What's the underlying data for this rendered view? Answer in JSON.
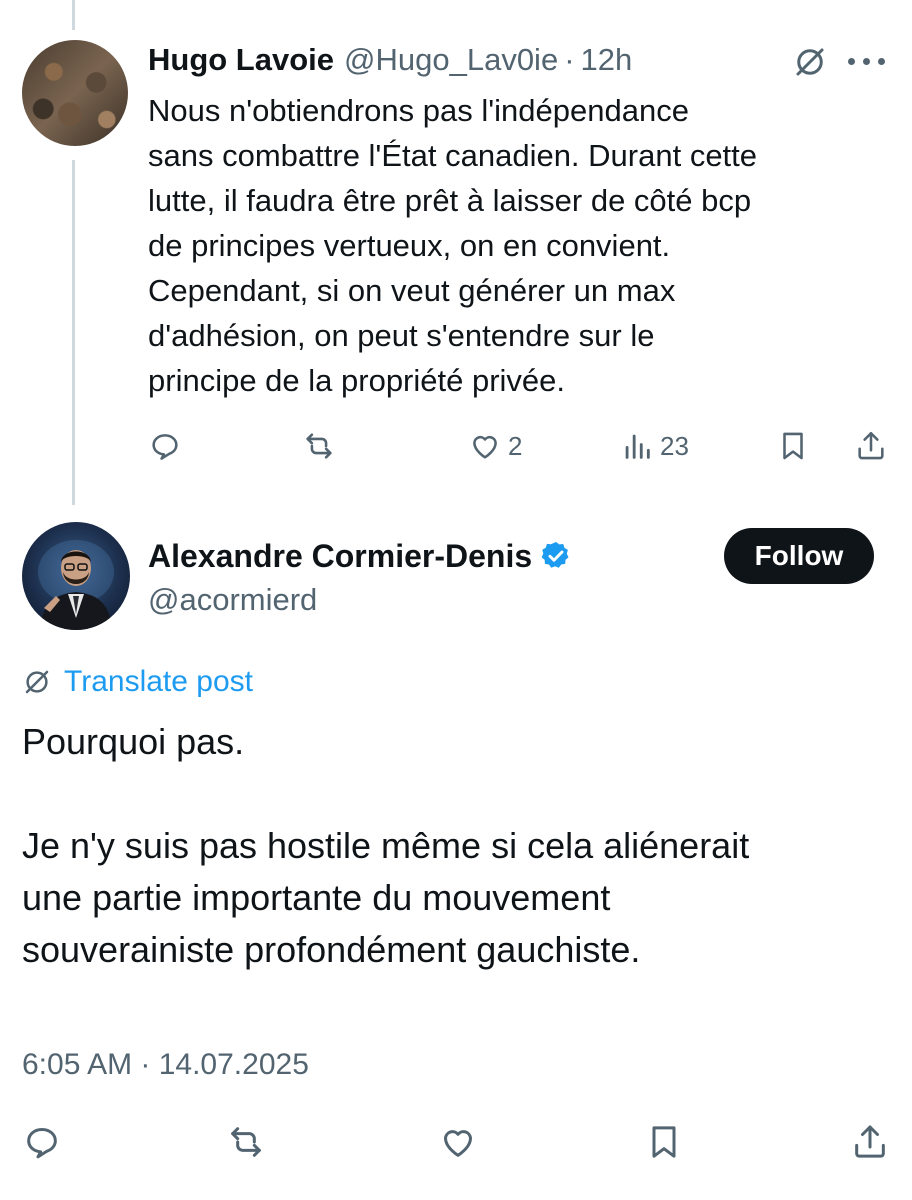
{
  "parent_post": {
    "author_name": "Hugo Lavoie",
    "author_handle": "@Hugo_Lav0ie",
    "separator": "·",
    "time": "12h",
    "text": "Nous n'obtiendrons pas l'indépendance sans combattre l'État canadien. Durant cette lutte, il faudra être prêt à laisser de côté bcp de principes vertueux, on en convient. Cependant, si on veut générer un max d'adhésion, on peut s'entendre sur le principe de la propriété privée.",
    "text_lines": [
      "Nous n'obtiendrons pas l'indépendance",
      "sans combattre l'État canadien. Durant cette",
      "lutte, il faudra être prêt à laisser de côté bcp",
      "de principes vertueux, on en convient.",
      "Cependant, si on veut générer un max",
      "d'adhésion, on peut s'entendre sur le",
      "principe de la propriété privée."
    ],
    "actions": {
      "reply_icon": "reply-icon",
      "repost_icon": "repost-icon",
      "like_icon": "like-icon",
      "like_count": "2",
      "views_icon": "views-icon",
      "views_count": "23",
      "bookmark_icon": "bookmark-icon",
      "share_icon": "share-icon"
    }
  },
  "main_post": {
    "author_name": "Alexandre Cormier-Denis",
    "author_handle": "@acormierd",
    "verified": true,
    "follow_label": "Follow",
    "translate_label": "Translate post",
    "paragraphs": [
      "Pourquoi pas.",
      "Je n'y suis pas hostile même si cela aliénerait une partie importante du mouvement souverainiste profondément gauchiste."
    ],
    "paragraph_lines": [
      [
        "Pourquoi pas."
      ],
      [
        "Je n'y suis pas hostile même si cela aliénerait",
        "une partie importante du mouvement",
        "souverainiste profondément gauchiste."
      ]
    ],
    "timestamp": "6:05 AM · 14.07.2025"
  },
  "colors": {
    "text": "#0f1419",
    "secondary": "#536471",
    "link": "#1d9bf0",
    "verified": "#1d9bf0",
    "follow_bg": "#0f1419",
    "thread_line": "#cfd9de"
  }
}
